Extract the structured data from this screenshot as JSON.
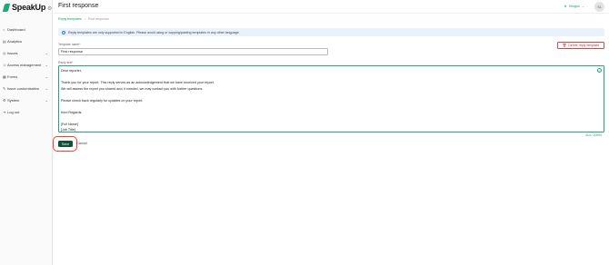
{
  "app": {
    "brand": "SpeakUp"
  },
  "sidebar": {
    "items": [
      {
        "label": "Dashboard",
        "icon": "home-icon",
        "glyph": "⌂",
        "chevron": ""
      },
      {
        "label": "Analytics",
        "icon": "chart-icon",
        "glyph": "▤",
        "chevron": ""
      },
      {
        "label": "Issues",
        "icon": "issues-icon",
        "glyph": "◎",
        "chevron": "⌄"
      },
      {
        "label": "Access management",
        "icon": "user-icon",
        "glyph": "☺",
        "chevron": "⌄"
      },
      {
        "label": "Forms",
        "icon": "forms-icon",
        "glyph": "▦",
        "chevron": "⌄"
      },
      {
        "label": "Issue customisation",
        "icon": "customise-icon",
        "glyph": "✎",
        "chevron": "⌄"
      },
      {
        "label": "System",
        "icon": "gear-icon",
        "glyph": "⚙",
        "chevron": "⌄"
      },
      {
        "label": "Log out",
        "icon": "logout-icon",
        "glyph": "⇥",
        "chevron": ""
      }
    ]
  },
  "header": {
    "title": "First response",
    "workspace": "Shogun",
    "avatar": "SL"
  },
  "breadcrumb": {
    "parent": "Reply templates",
    "separator": "›",
    "current": "First response"
  },
  "banner": {
    "text": "Reply templates are only supported in English. Please avoid using or copying/pasting templates in any other language."
  },
  "form": {
    "name_label": "Template name",
    "name_value": "First response",
    "text_label": "Reply text",
    "required_mark": "*",
    "delete_label": "Delete reply template",
    "lines": [
      "Dear reporter,",
      "",
      "Thank you for your report. This reply serves as an acknowledgement that we have received your report.",
      "We will assess the report you shared and, if needed, we may contact you with further questions.",
      "",
      "Please check back regularly for updates on your report.",
      "",
      "Kind Regards,",
      "",
      "[Full Name]",
      "[Job Title]"
    ],
    "counter": "314 / 10000",
    "save_label": "Save",
    "cancel_label": "Cancel"
  },
  "colors": {
    "brand": "#1fa87a",
    "save": "#11503c",
    "danger": "#c53030",
    "highlight": "#ff3b30",
    "banner": "#e8f1fc"
  }
}
